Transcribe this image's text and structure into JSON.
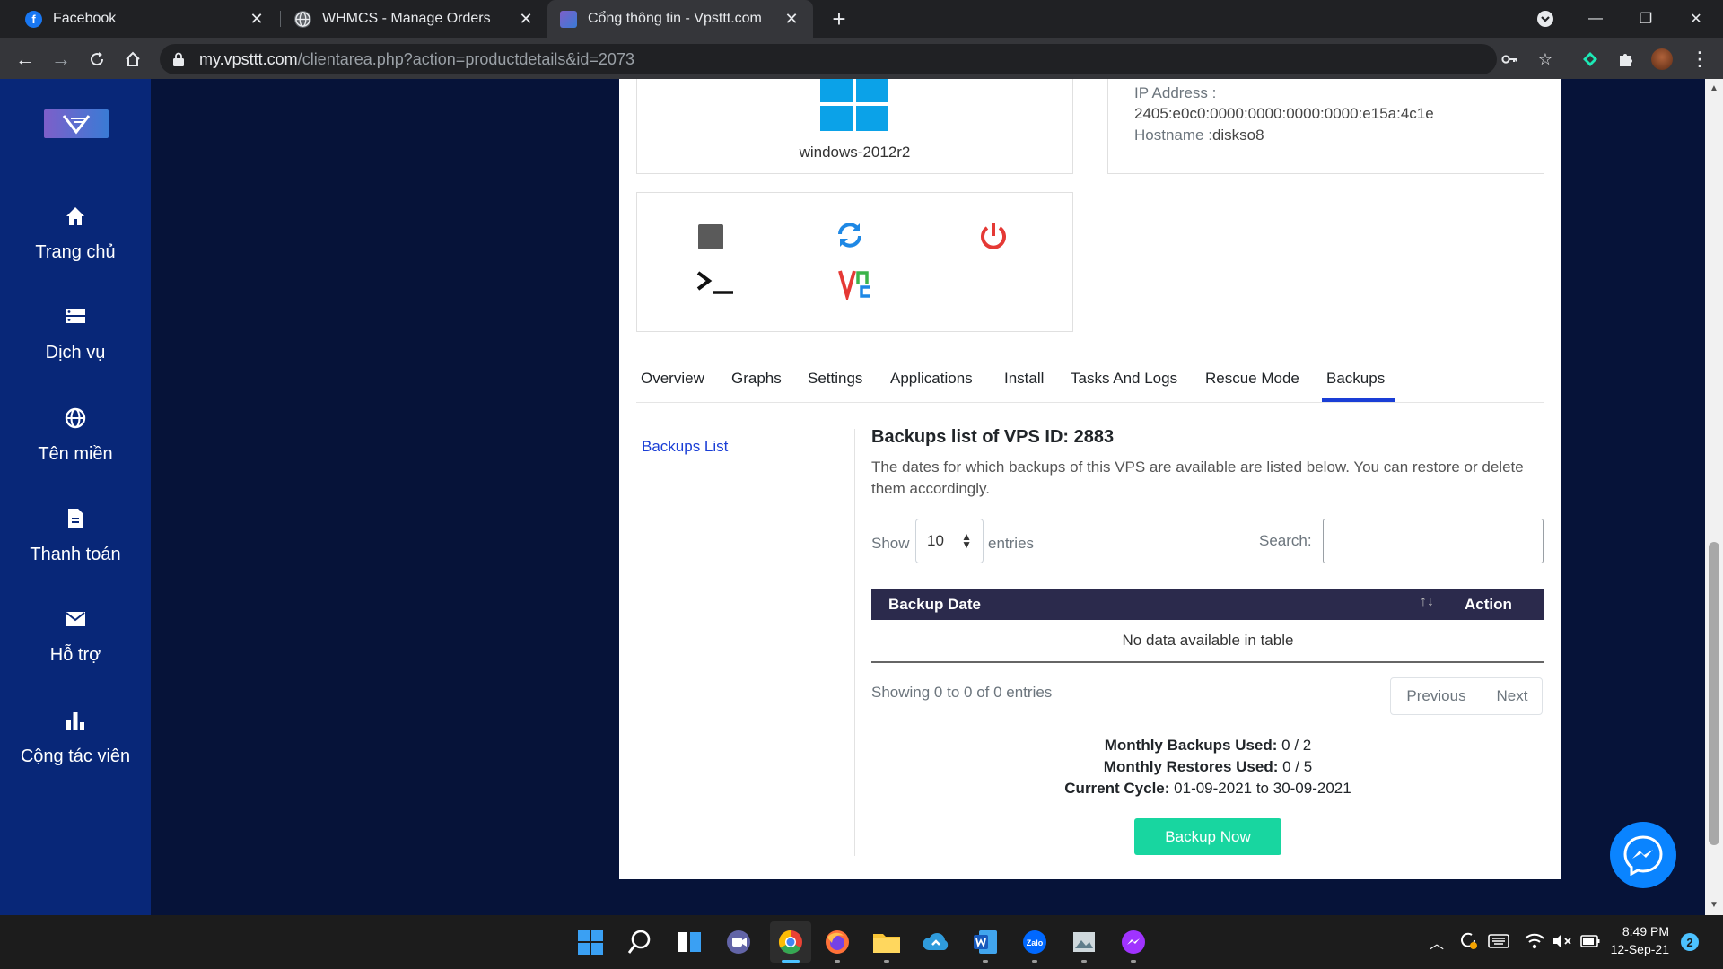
{
  "browser": {
    "tabs": [
      {
        "title": "Facebook",
        "icon": "facebook-icon",
        "active": false
      },
      {
        "title": "WHMCS - Manage Orders",
        "icon": "globe-icon",
        "active": false
      },
      {
        "title": "Cổng thông tin - Vpsttt.com",
        "icon": "site-icon",
        "active": true
      }
    ],
    "url_host": "my.vpsttt.com",
    "url_path": "/clientarea.php?action=productdetails&id=2073"
  },
  "sidebar": {
    "logo_text": "V",
    "items": [
      {
        "label": "Trang chủ",
        "icon": "home-icon"
      },
      {
        "label": "Dịch vụ",
        "icon": "server-icon"
      },
      {
        "label": "Tên miền",
        "icon": "globe-icon"
      },
      {
        "label": "Thanh toán",
        "icon": "document-icon"
      },
      {
        "label": "Hỗ trợ",
        "icon": "mail-icon"
      },
      {
        "label": "Cộng tác viên",
        "icon": "bar-chart-icon"
      }
    ]
  },
  "vps": {
    "os_name": "windows-2012r2",
    "ip_label": "IP Address :",
    "ip_value": "2405:e0c0:0000:0000:0000:0000:e15a:4c1e",
    "hostname_label": "Hostname :",
    "hostname_value": "diskso8"
  },
  "tabs": {
    "items": [
      "Overview",
      "Graphs",
      "Settings",
      "Applications",
      "Install",
      "Tasks And Logs",
      "Rescue Mode",
      "Backups"
    ],
    "active": "Backups"
  },
  "backups": {
    "side_link": "Backups List",
    "heading": "Backups list of VPS ID: 2883",
    "description": "The dates for which backups of this VPS are available are listed below. You can restore or delete them accordingly.",
    "show_label": "Show",
    "entries_value": "10",
    "entries_label": "entries",
    "search_label": "Search:",
    "search_value": "",
    "table": {
      "columns": [
        "Backup Date",
        "Action"
      ],
      "empty_text": "No data available in table"
    },
    "showing_text": "Showing 0 to 0 of 0 entries",
    "prev_label": "Previous",
    "next_label": "Next",
    "monthly_backups_label": "Monthly Backups Used:",
    "monthly_backups_value": "0 / 2",
    "monthly_restores_label": "Monthly Restores Used:",
    "monthly_restores_value": "0 / 5",
    "cycle_label": "Current Cycle:",
    "cycle_value": "01-09-2021 to 30-09-2021",
    "backup_button": "Backup Now"
  },
  "colors": {
    "sidebar_bg": "#082778",
    "page_bg": "#061339",
    "table_header_bg": "#2b2a4c",
    "accent_link": "#1a3ed6",
    "backup_button": "#18d6a0",
    "power_red": "#e53935",
    "refresh_blue": "#1e88e5"
  },
  "taskbar": {
    "time": "8:49 PM",
    "date": "12-Sep-21",
    "notification_count": "2"
  }
}
